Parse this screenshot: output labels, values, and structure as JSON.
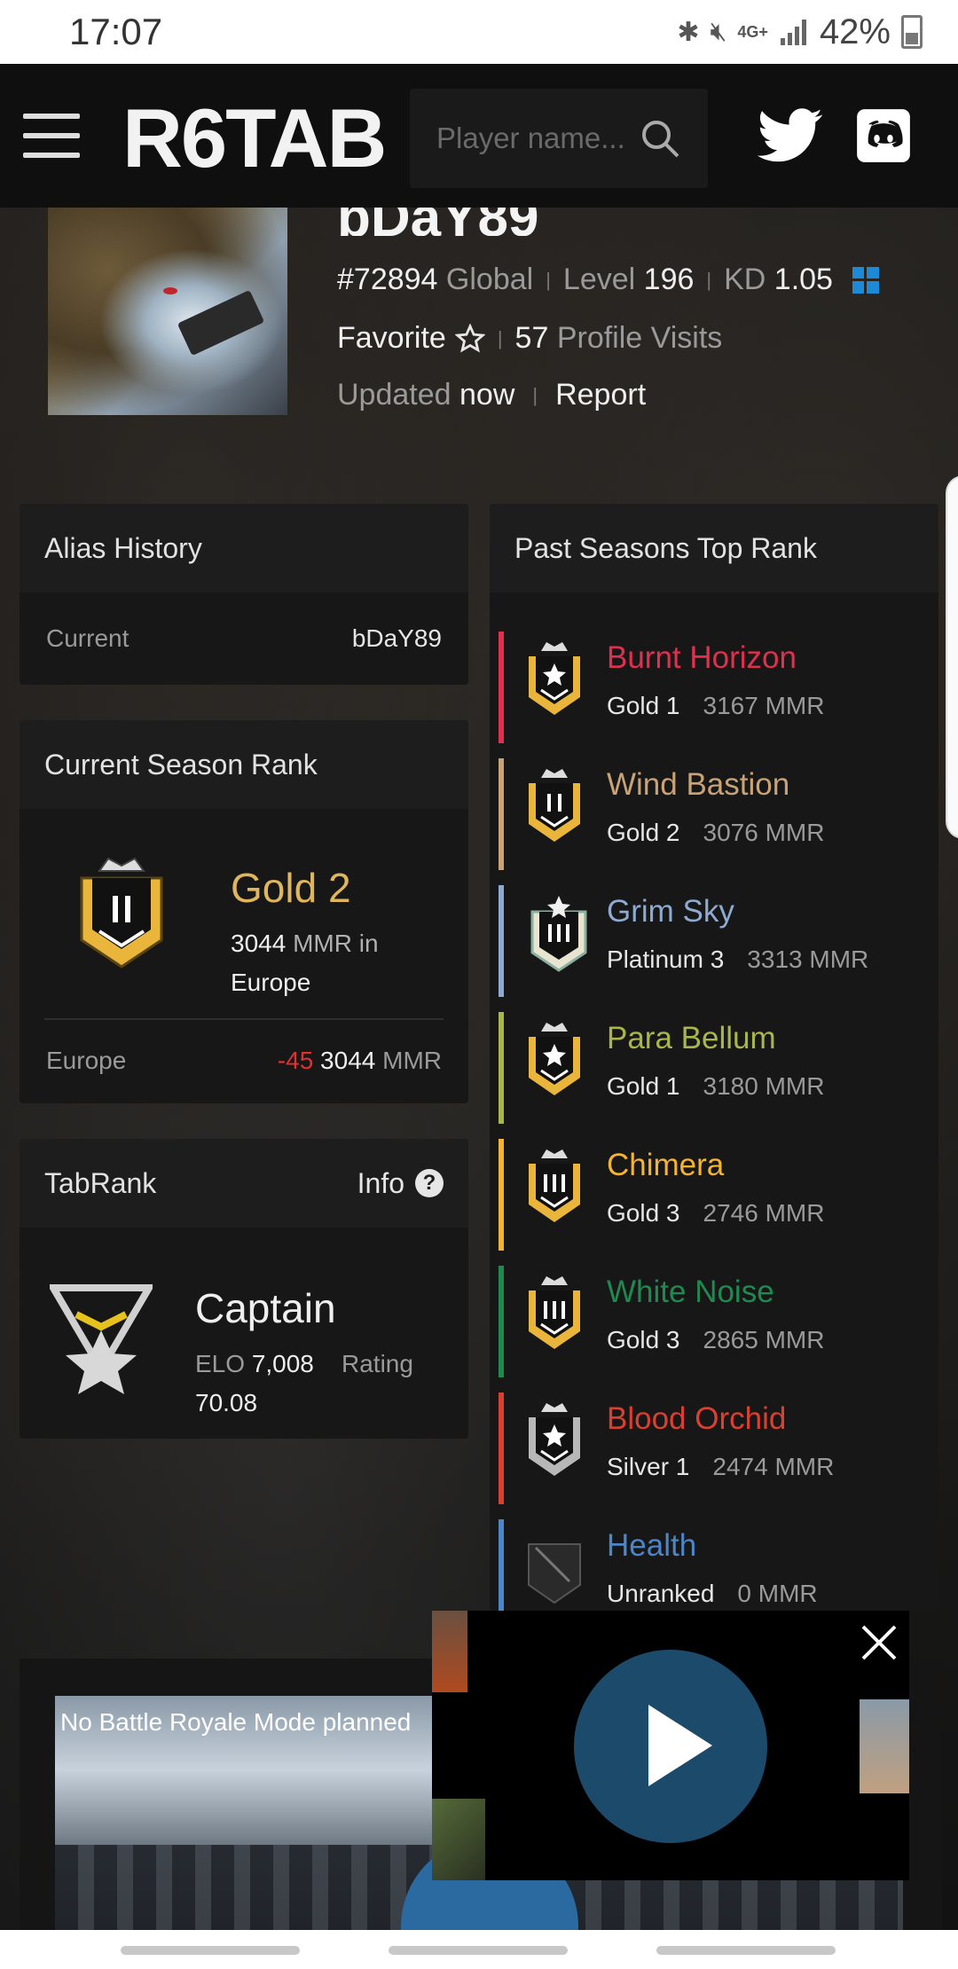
{
  "status_bar": {
    "time": "17:07",
    "network": "4G+",
    "battery": "42%",
    "icons": [
      "bluetooth-icon",
      "mute-icon",
      "signal-icon",
      "battery-icon"
    ]
  },
  "header": {
    "logo": "R6TAB",
    "search_placeholder": "Player name...",
    "icons": [
      "menu-icon",
      "search-icon",
      "twitter-icon",
      "discord-icon"
    ]
  },
  "profile": {
    "username": "bDaY89",
    "global_rank": "#72894",
    "global_label": "Global",
    "level_label": "Level",
    "level": "196",
    "kd_label": "KD",
    "kd": "1.05",
    "platform_icon": "windows-icon",
    "favorite_label": "Favorite",
    "profile_visits": "57",
    "profile_visits_label": "Profile Visits",
    "updated_label": "Updated",
    "updated_value": "now",
    "report_label": "Report"
  },
  "alias_history": {
    "title": "Alias History",
    "label": "Current",
    "value": "bDaY89"
  },
  "current_season": {
    "title": "Current Season Rank",
    "rank": "Gold 2",
    "mmr": "3044",
    "mmr_suffix": "MMR in",
    "region": "Europe",
    "region_row_label": "Europe",
    "delta": "-45",
    "region_mmr": "3044",
    "mmr_unit": "MMR"
  },
  "tabrank": {
    "title": "TabRank",
    "info_label": "Info",
    "rank": "Captain",
    "elo_label": "ELO",
    "elo": "7,008",
    "rating_label": "Rating",
    "rating": "70.08"
  },
  "past_seasons": {
    "title": "Past Seasons Top Rank",
    "items": [
      {
        "season": "Burnt Horizon",
        "rank": "Gold 1",
        "mmr": "3167 MMR",
        "color": "#e0304e"
      },
      {
        "season": "Wind Bastion",
        "rank": "Gold 2",
        "mmr": "3076 MMR",
        "color": "#c9a276"
      },
      {
        "season": "Grim Sky",
        "rank": "Platinum 3",
        "mmr": "3313 MMR",
        "color": "#8eaad0"
      },
      {
        "season": "Para Bellum",
        "rank": "Gold 1",
        "mmr": "3180 MMR",
        "color": "#a9b64a"
      },
      {
        "season": "Chimera",
        "rank": "Gold 3",
        "mmr": "2746 MMR",
        "color": "#f2b431"
      },
      {
        "season": "White Noise",
        "rank": "Gold 3",
        "mmr": "2865 MMR",
        "color": "#1f8a50"
      },
      {
        "season": "Blood Orchid",
        "rank": "Silver 1",
        "mmr": "2474 MMR",
        "color": "#d94030"
      },
      {
        "season": "Health",
        "rank": "Unranked",
        "mmr": "0 MMR",
        "color": "#4a86c8"
      }
    ]
  },
  "news": {
    "title": "No Battle Royale Mode planned"
  }
}
